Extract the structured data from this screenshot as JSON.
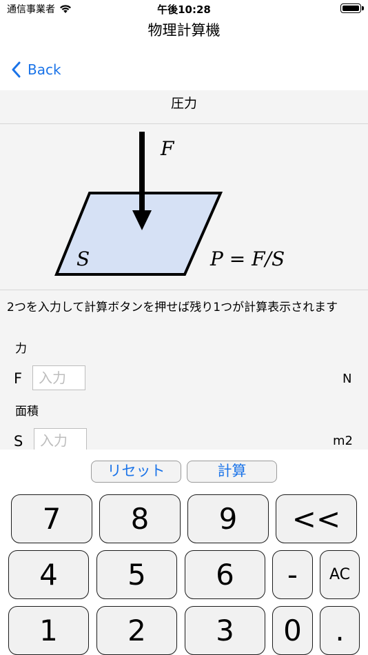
{
  "status": {
    "carrier": "通信事業者",
    "time": "午後10:28"
  },
  "nav": {
    "title": "物理計算機",
    "back_label": "Back"
  },
  "section": {
    "title": "圧力"
  },
  "diagram": {
    "force_label": "F",
    "area_label": "S",
    "formula": "P = F/S"
  },
  "instruction": "2つを入力して計算ボタンを押せば残り1つが計算表示されます",
  "fields": [
    {
      "caption": "力",
      "symbol": "F",
      "placeholder": "入力",
      "value": "",
      "unit": "N"
    },
    {
      "caption": "面積",
      "symbol": "S",
      "placeholder": "入力",
      "value": "",
      "unit": "m2"
    }
  ],
  "actions": {
    "reset_label": "リセット",
    "calc_label": "計算"
  },
  "keys": {
    "row1": [
      "7",
      "8",
      "9",
      "<<"
    ],
    "row2": [
      "4",
      "5",
      "6",
      "-",
      "AC"
    ],
    "row3": [
      "1",
      "2",
      "3",
      "0",
      "."
    ]
  },
  "colors": {
    "accent": "#1a73e8",
    "content_bg": "#f4f4f4",
    "parallelogram_fill": "#d6e1f5"
  }
}
